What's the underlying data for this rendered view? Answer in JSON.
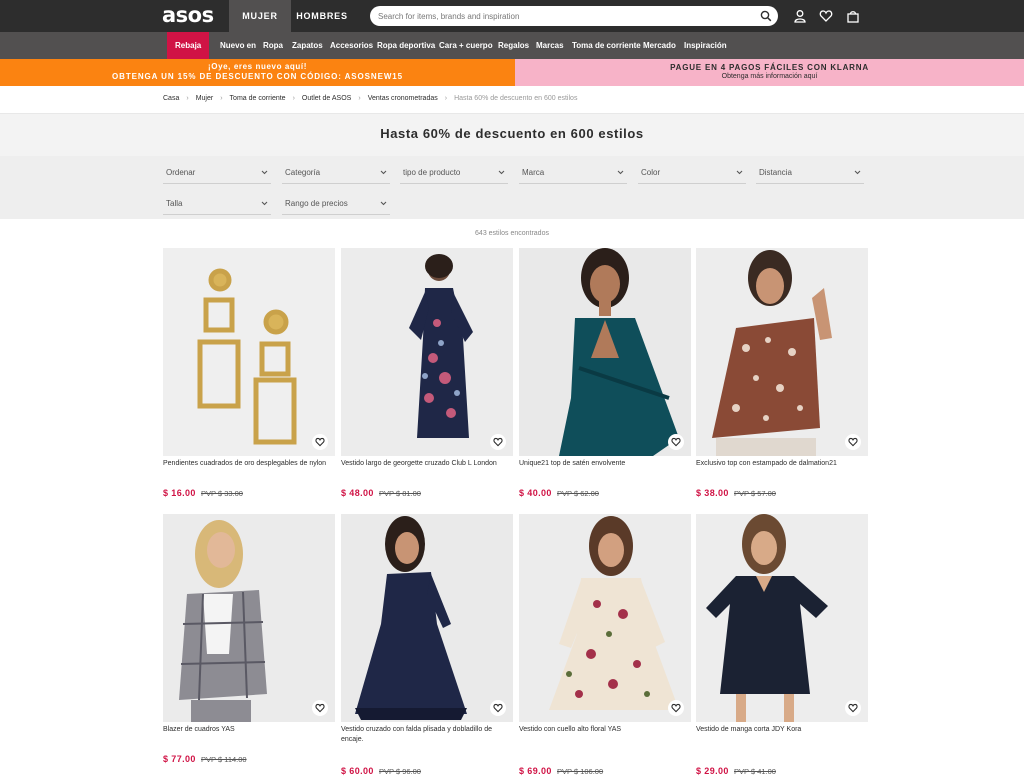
{
  "header": {
    "logo": "asos",
    "tabs": [
      "MUJER",
      "HOMBRES"
    ],
    "search_placeholder": "Search for items, brands and inspiration",
    "icons": [
      "search-icon",
      "account-icon",
      "heart-icon",
      "bag-icon"
    ]
  },
  "nav": {
    "items": [
      "Rebaja",
      "Nuevo en",
      "Ropa",
      "Zapatos",
      "Accesorios",
      "Ropa deportiva",
      "Cara + cuerpo",
      "Regalos",
      "Marcas",
      "Toma de corriente",
      "Mercado",
      "Inspiración"
    ],
    "sale_color": "#d01345"
  },
  "promos": {
    "left_line1": "¡Oye, eres nuevo aquí!",
    "left_line2": "OBTENGA UN 15% DE DESCUENTO CON CÓDIGO: ASOSNEW15",
    "left_color": "#fb8311",
    "right_line1": "PAGUE EN 4 PAGOS FÁCILES CON KLARNA",
    "right_line2": "Obtenga más información aquí",
    "right_color": "#f7b3c8"
  },
  "breadcrumb": [
    "Casa",
    "Mujer",
    "Toma de corriente",
    "Outlet de ASOS",
    "Ventas cronometradas",
    "Hasta 60% de descuento en 600 estilos"
  ],
  "page_title": "Hasta 60% de descuento en 600 estilos",
  "filters": [
    "Ordenar",
    "Categoría",
    "tipo de producto",
    "Marca",
    "Color",
    "Distancia",
    "Talla",
    "Rango de precios"
  ],
  "results_count": "643 estilos encontrados",
  "products": [
    {
      "name": "Pendientes cuadrados de oro desplegables de nylon",
      "price": "$ 16.00",
      "rrp": "PVP $ 33.00"
    },
    {
      "name": "Vestido largo de georgette cruzado Club L London",
      "price": "$ 48.00",
      "rrp": "PVP $ 81.00"
    },
    {
      "name": "Unique21 top de satén envolvente",
      "price": "$ 40.00",
      "rrp": "PVP $ 62.00"
    },
    {
      "name": "Exclusivo top con estampado de dalmation21",
      "price": "$ 38.00",
      "rrp": "PVP $ 57.00"
    },
    {
      "name": "Blazer de cuadros YAS",
      "price": "$ 77.00",
      "rrp": "PVP $ 114.00"
    },
    {
      "name": "Vestido cruzado con falda plisada y dobladillo de encaje.",
      "price": "$ 60.00",
      "rrp": "PVP $ 96.00"
    },
    {
      "name": "Vestido con cuello alto floral YAS",
      "price": "$ 69.00",
      "rrp": "PVP $ 106.00"
    },
    {
      "name": "Vestido de manga corta JDY Kora",
      "price": "$ 29.00",
      "rrp": "PVP $ 41.00"
    }
  ],
  "price_color": "#d01345"
}
